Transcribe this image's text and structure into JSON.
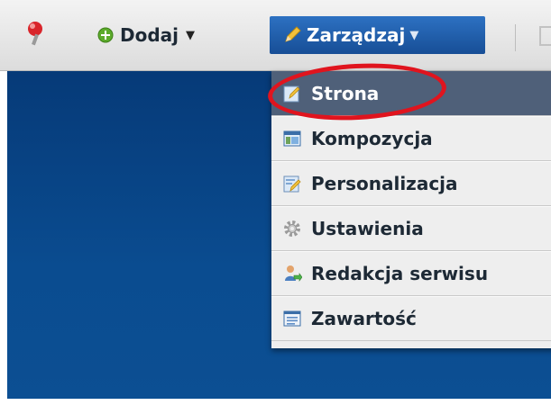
{
  "toolbar": {
    "add_label": "Dodaj",
    "manage_label": "Zarządzaj"
  },
  "menu": {
    "items": [
      {
        "label": "Strona",
        "icon": "page-edit-icon",
        "selected": true
      },
      {
        "label": "Kompozycja",
        "icon": "layout-icon"
      },
      {
        "label": "Personalizacja",
        "icon": "personalize-icon"
      },
      {
        "label": "Ustawienia",
        "icon": "gear-icon"
      },
      {
        "label": "Redakcja serwisu",
        "icon": "user-arrow-icon"
      },
      {
        "label": "Zawartość",
        "icon": "content-list-icon"
      }
    ]
  },
  "colors": {
    "accent_blue": "#1f5fae",
    "selected_item": "#4f6079",
    "highlight_ring": "#e0141e"
  }
}
